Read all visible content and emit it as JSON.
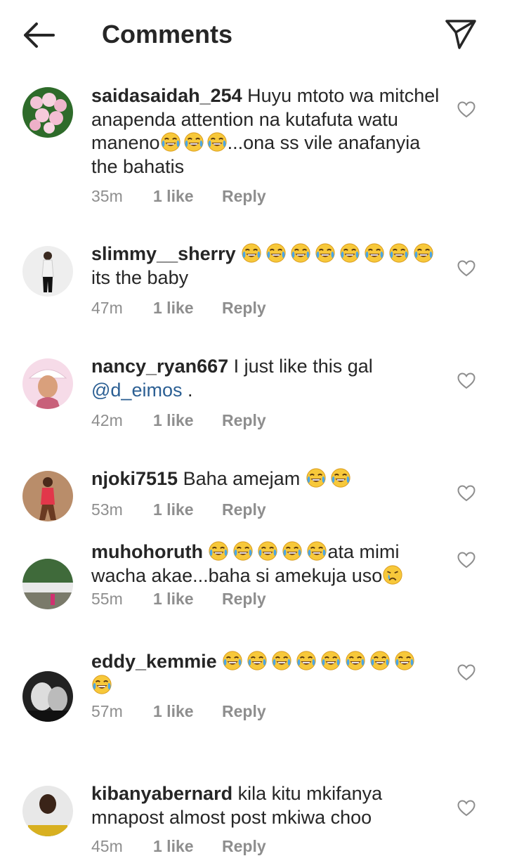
{
  "header": {
    "title": "Comments",
    "back_icon": "arrow-left-icon",
    "share_icon": "paper-plane-icon"
  },
  "emoji": {
    "laugh": "face-with-tears-of-joy",
    "cry": "crying-face"
  },
  "comments": [
    {
      "username": "saidasaidah_254",
      "text_1": "Huyu mtoto wa mitchel anapenda attention na kutafuta watu maneno",
      "text_2": "...ona ss vile anafanyia the bahatis",
      "time": "35m",
      "likes": "1 like",
      "reply": "Reply"
    },
    {
      "username": "slimmy__sherry",
      "text_1": "its the baby",
      "time": "47m",
      "likes": "1 like",
      "reply": "Reply"
    },
    {
      "username": "nancy_ryan667",
      "text_1": "I just like this gal",
      "mention": "@d_eimos",
      "text_2": " .",
      "time": "42m",
      "likes": "1 like",
      "reply": "Reply"
    },
    {
      "username": "njoki7515",
      "text_1": "Baha amejam",
      "time": "53m",
      "likes": "1 like",
      "reply": "Reply"
    },
    {
      "username": "muhohoruth",
      "text_1": "ata mimi wacha akae...baha si amekuja uso",
      "time": "55m",
      "likes": "1 like",
      "reply": "Reply"
    },
    {
      "username": "eddy_kemmie",
      "time": "57m",
      "likes": "1 like",
      "reply": "Reply"
    },
    {
      "username": "kibanyabernard",
      "text_1": "kila kitu mkifanya mnapost almost post mkiwa choo",
      "time": "45m",
      "likes": "1 like",
      "reply": "Reply"
    }
  ]
}
